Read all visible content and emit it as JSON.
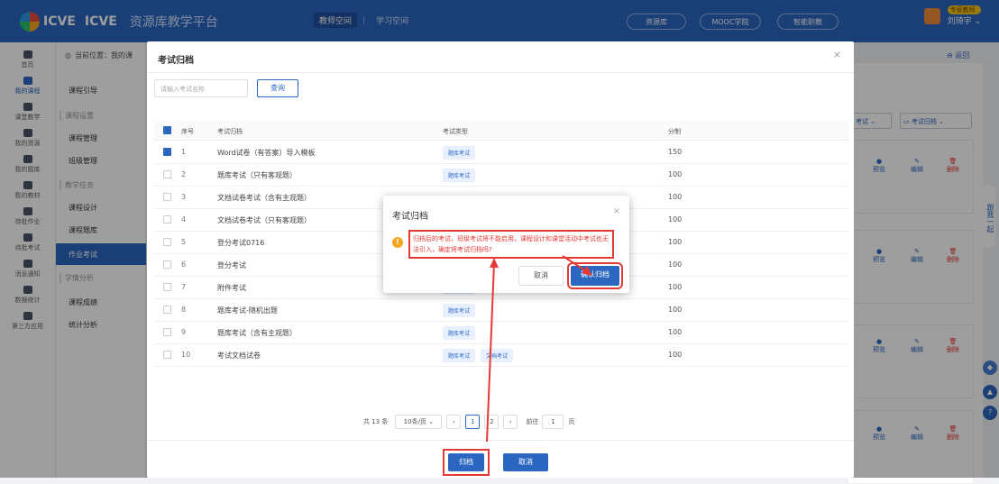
{
  "header": {
    "logo_icve": "ICVE",
    "logo_icve2": "ICVE",
    "platform": "资源库教学平台",
    "tabs": [
      {
        "label": "教师空间",
        "active": true
      },
      {
        "label": "学习空间",
        "active": false
      }
    ],
    "pills": [
      "资源库",
      "MOOC学院",
      "智能职教"
    ],
    "user_badge": "专家教师",
    "user_name": "刘琦宇"
  },
  "sidebar": {
    "items": [
      {
        "label": "首页",
        "icon": "home-icon"
      },
      {
        "label": "我的课程",
        "icon": "course-icon",
        "active": true
      },
      {
        "label": "课堂教学",
        "icon": "classroom-icon"
      },
      {
        "label": "我的资源",
        "icon": "resource-icon"
      },
      {
        "label": "我的题库",
        "icon": "question-bank-icon"
      },
      {
        "label": "我的教材",
        "icon": "textbook-icon"
      },
      {
        "label": "待批作业",
        "icon": "homework-icon"
      },
      {
        "label": "待批考试",
        "icon": "exam-icon"
      },
      {
        "label": "消息通知",
        "icon": "message-icon"
      },
      {
        "label": "数据统计",
        "icon": "stats-icon"
      },
      {
        "label": "第三方应用",
        "icon": "apps-icon"
      }
    ]
  },
  "breadcrumb": "当前位置：我的课",
  "submenu": {
    "items": [
      {
        "label": "课程引导",
        "type": "item"
      },
      {
        "label": "课程设置",
        "type": "group"
      },
      {
        "label": "课程管理",
        "type": "item"
      },
      {
        "label": "班级管理",
        "type": "item"
      },
      {
        "label": "教学任务",
        "type": "group"
      },
      {
        "label": "课程设计",
        "type": "item"
      },
      {
        "label": "课程题库",
        "type": "item"
      },
      {
        "label": "学情分析",
        "type": "group"
      },
      {
        "label": "课程成绩",
        "type": "item"
      },
      {
        "label": "统计分析",
        "type": "item"
      }
    ],
    "active": "作业考试"
  },
  "background": {
    "back_label": "返回",
    "filter1": "考试",
    "filter2": "考试归档",
    "preview": "预览",
    "edit": "编辑",
    "delete": "删除",
    "side_text": "跟我一起"
  },
  "dialog": {
    "title": "考试归档",
    "search_placeholder": "请输入考试名称",
    "query_label": "查询",
    "columns": [
      "序号",
      "考试归档",
      "考试类型",
      "分制"
    ],
    "rows": [
      {
        "no": "1",
        "name": "Word试卷（有答案）导入模板",
        "types": [
          "题库考试"
        ],
        "score": "150",
        "checked": true
      },
      {
        "no": "2",
        "name": "题库考试（只有客观题）",
        "types": [
          "题库考试"
        ],
        "score": "100",
        "checked": false
      },
      {
        "no": "3",
        "name": "文档试卷考试（含有主观题）",
        "types": [],
        "score": "100",
        "checked": false
      },
      {
        "no": "4",
        "name": "文档试卷考试（只有客观题）",
        "types": [],
        "score": "100",
        "checked": false
      },
      {
        "no": "5",
        "name": "登分考试0716",
        "types": [],
        "score": "100",
        "checked": false
      },
      {
        "no": "6",
        "name": "登分考试",
        "types": [],
        "score": "100",
        "checked": false
      },
      {
        "no": "7",
        "name": "附件考试",
        "types": [
          "附件考试"
        ],
        "score": "100",
        "checked": false
      },
      {
        "no": "8",
        "name": "题库考试-随机出题",
        "types": [
          "题库考试"
        ],
        "score": "100",
        "checked": false
      },
      {
        "no": "9",
        "name": "题库考试（含有主观题）",
        "types": [
          "题库考试"
        ],
        "score": "100",
        "checked": false
      },
      {
        "no": "10",
        "name": "考试文档试卷",
        "types": [
          "题库考试",
          "文档考试"
        ],
        "score": "100",
        "checked": false
      }
    ],
    "pagination": {
      "total": "共 13 条",
      "page_size": "10条/页",
      "pages": [
        "1",
        "2"
      ],
      "goto_label": "前往",
      "goto_value": "1",
      "page_unit": "页"
    },
    "archive_label": "归档",
    "cancel_label": "取消"
  },
  "confirm": {
    "title": "考试归档",
    "message": "归档后的考试，班级考试将不能启用，课程设计和课堂活动中考试也无法引入，确定将考试归档吗?",
    "cancel_label": "取消",
    "ok_label": "确认归档"
  },
  "colors": {
    "primary": "#2b66c0",
    "danger": "#e53935",
    "warning": "#f5a623"
  }
}
